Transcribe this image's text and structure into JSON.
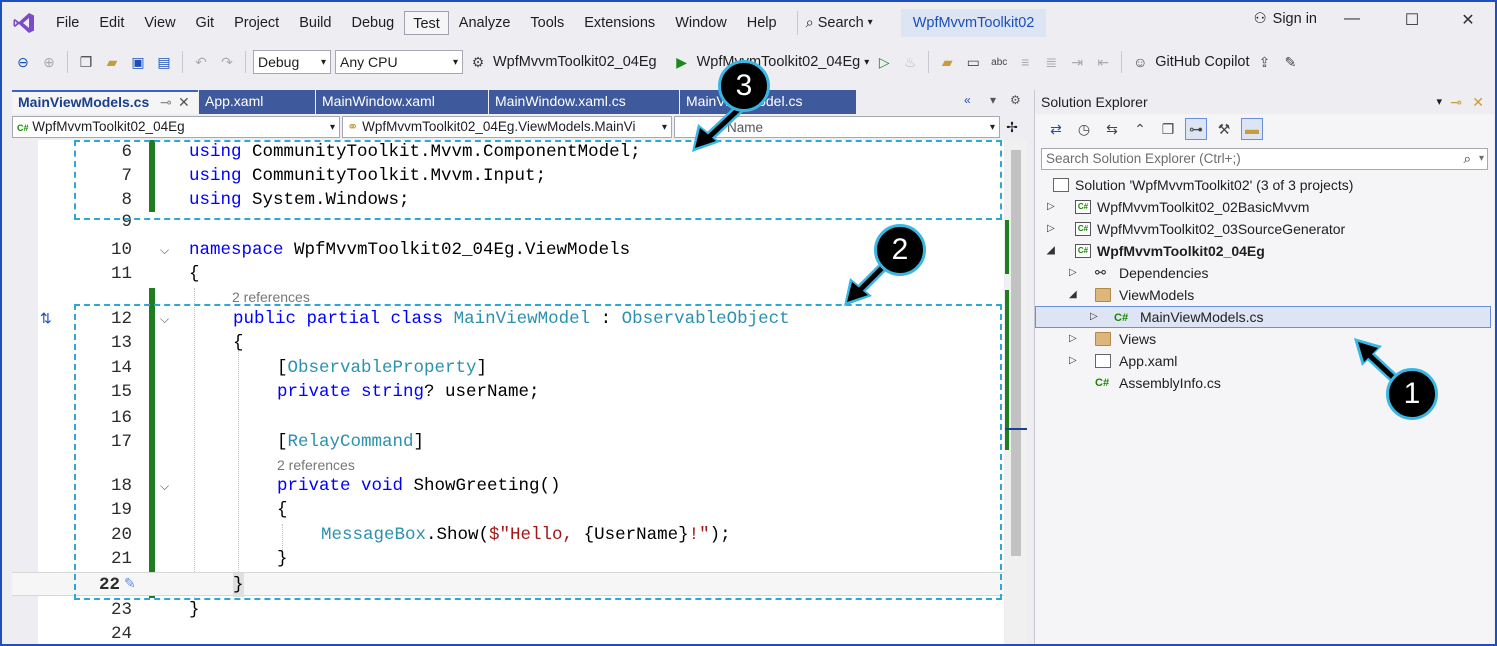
{
  "menu": {
    "items": [
      "File",
      "Edit",
      "View",
      "Git",
      "Project",
      "Build",
      "Debug",
      "Test",
      "Analyze",
      "Tools",
      "Extensions",
      "Window",
      "Help"
    ],
    "search": "Search",
    "solution_name": "WpfMvvmToolkit02",
    "sign_in": "Sign in"
  },
  "toolbar": {
    "config": "Debug",
    "platform": "Any CPU",
    "startup_project": "WpfMvvmToolkit02_04Eg",
    "run_target": "WpfMvvmToolkit02_04Eg",
    "copilot": "GitHub Copilot"
  },
  "tabs": [
    "MainViewModels.cs",
    "App.xaml",
    "MainWindow.xaml",
    "MainWindow.xaml.cs",
    "MainViewModel.cs"
  ],
  "navbar": {
    "project": "WpfMvvmToolkit02_04Eg",
    "type": "WpfMvvmToolkit02_04Eg.ViewModels.MainVi",
    "member": "Name"
  },
  "code": {
    "line_numbers": [
      "6",
      "7",
      "8",
      "9",
      "10",
      "11",
      "12",
      "13",
      "14",
      "15",
      "16",
      "17",
      "18",
      "19",
      "20",
      "21",
      "22",
      "23",
      "24"
    ],
    "l6_kw": "using",
    "l6_rest": " CommunityToolkit.Mvvm.ComponentModel;",
    "l7_kw": "using",
    "l7_rest": " CommunityToolkit.Mvvm.Input;",
    "l8_kw": "using",
    "l8_rest": " System.Windows;",
    "l10_kw": "namespace",
    "l10_rest": " WpfMvvmToolkit02_04Eg.ViewModels",
    "l11": "{",
    "refs1": "2 references",
    "l12_kw": "public partial class",
    "l12_type": "MainViewModel",
    "l12_colon": " : ",
    "l12_base": "ObservableObject",
    "l13": "{",
    "l14_open": "[",
    "l14_attr": "ObservableProperty",
    "l14_close": "]",
    "l15_kw": "private string",
    "l15_rest": "? userName;",
    "l17_open": "[",
    "l17_attr": "RelayCommand",
    "l17_close": "]",
    "refs2": "2 references",
    "l18_kw": "private void",
    "l18_rest": " ShowGreeting()",
    "l19": "{",
    "l20_type": "MessageBox",
    "l20_dot": ".Show(",
    "l20_str": "$\"Hello, ",
    "l20_interp": "{UserName}",
    "l20_str2": "!\"",
    "l20_end": ");",
    "l21": "}",
    "l22": "}",
    "l23": "}"
  },
  "solution_explorer": {
    "title": "Solution Explorer",
    "search_placeholder": "Search Solution Explorer (Ctrl+;)",
    "tree": [
      {
        "label": "Solution 'WpfMvvmToolkit02' (3 of 3 projects)"
      },
      {
        "label": "WpfMvvmToolkit02_02BasicMvvm"
      },
      {
        "label": "WpfMvvmToolkit02_03SourceGenerator"
      },
      {
        "label": "WpfMvvmToolkit02_04Eg"
      },
      {
        "label": "Dependencies"
      },
      {
        "label": "ViewModels"
      },
      {
        "label": "MainViewModels.cs"
      },
      {
        "label": "Views"
      },
      {
        "label": "App.xaml"
      },
      {
        "label": "AssemblyInfo.cs"
      }
    ]
  },
  "annotations": {
    "badge1": "1",
    "badge2": "2",
    "badge3": "3"
  },
  "colors": {
    "accent": "#3b63c4",
    "keyword": "#0000ff",
    "type": "#2b91af",
    "string": "#a31515",
    "change_bar": "#1f7d1f",
    "callout": "#3ab6e3"
  }
}
